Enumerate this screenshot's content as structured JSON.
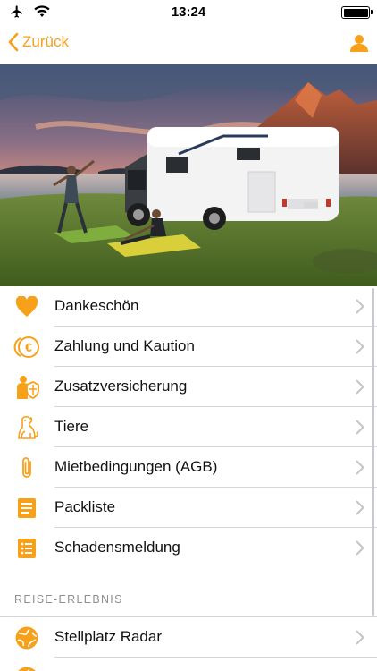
{
  "status": {
    "time": "13:24"
  },
  "nav": {
    "back_label": "Zurück"
  },
  "menu": [
    {
      "label": "Dankeschön",
      "icon": "heart-icon"
    },
    {
      "label": "Zahlung und Kaution",
      "icon": "euro-coin-icon"
    },
    {
      "label": "Zusatzversicherung",
      "icon": "insurance-shield-icon"
    },
    {
      "label": "Tiere",
      "icon": "dog-icon"
    },
    {
      "label": "Mietbedingungen (AGB)",
      "icon": "paperclip-icon"
    },
    {
      "label": "Packliste",
      "icon": "checklist-icon"
    },
    {
      "label": "Schadensmeldung",
      "icon": "list-icon"
    }
  ],
  "section": {
    "title": "REISE-ERLEBNIS"
  },
  "menu2": [
    {
      "label": "Stellplatz Radar",
      "icon": "globe-icon"
    }
  ],
  "colors": {
    "accent": "#f7a11a",
    "separator": "#d7d7db",
    "section_text": "#8e8e93"
  }
}
